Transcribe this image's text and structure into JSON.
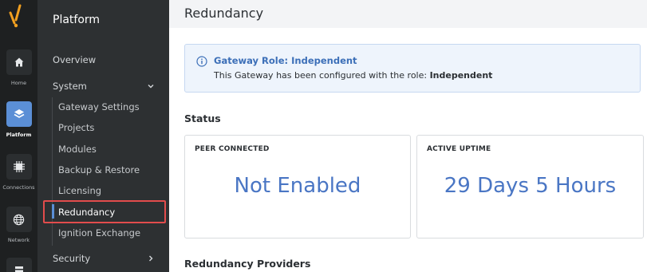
{
  "rail": {
    "items": [
      {
        "label": "Home"
      },
      {
        "label": "Platform"
      },
      {
        "label": "Connections"
      },
      {
        "label": "Network"
      }
    ]
  },
  "nav": {
    "title": "Platform",
    "overview": "Overview",
    "system": "System",
    "system_items": [
      "Gateway Settings",
      "Projects",
      "Modules",
      "Backup & Restore",
      "Licensing",
      "Redundancy",
      "Ignition Exchange"
    ],
    "security": "Security"
  },
  "main": {
    "title": "Redundancy",
    "alert": {
      "title": "Gateway Role: Independent",
      "text_prefix": "This Gateway has been configured with the role: ",
      "role": "Independent"
    },
    "status_label": "Status",
    "cards": [
      {
        "heading": "PEER CONNECTED",
        "value": "Not Enabled"
      },
      {
        "heading": "ACTIVE UPTIME",
        "value": "29 Days 5 Hours"
      }
    ],
    "providers_label": "Redundancy Providers"
  },
  "colors": {
    "accent": "#5b8fd6",
    "value_blue": "#4a76c4",
    "highlight_red": "#e24c4c"
  }
}
